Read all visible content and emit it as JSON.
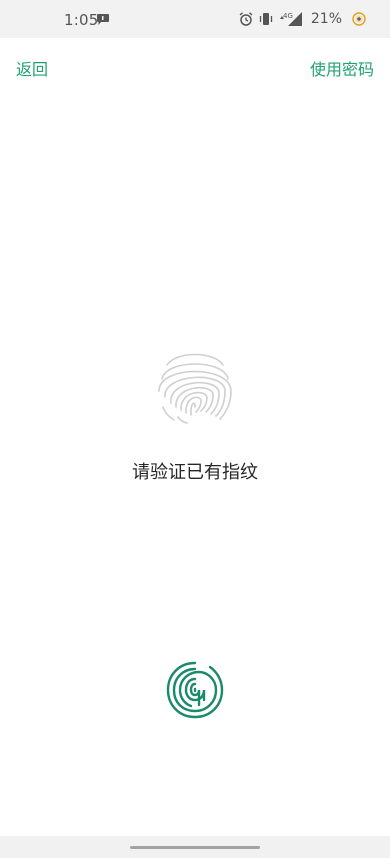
{
  "status_bar": {
    "time": "1:05",
    "battery_percent": "21%",
    "network": "4G",
    "icons": [
      "message-icon",
      "alarm-icon",
      "vibrate-icon",
      "signal-icon",
      "battery-saver-icon"
    ]
  },
  "nav": {
    "back_label": "返回",
    "use_password_label": "使用密码"
  },
  "main": {
    "prompt": "请验证已有指纹"
  },
  "colors": {
    "accent": "#1fa370",
    "fingerprint_sensor": "#1a8a6a",
    "fingerprint_gray": "#cfcfcf",
    "status_bar_bg": "#f2f2f2"
  }
}
